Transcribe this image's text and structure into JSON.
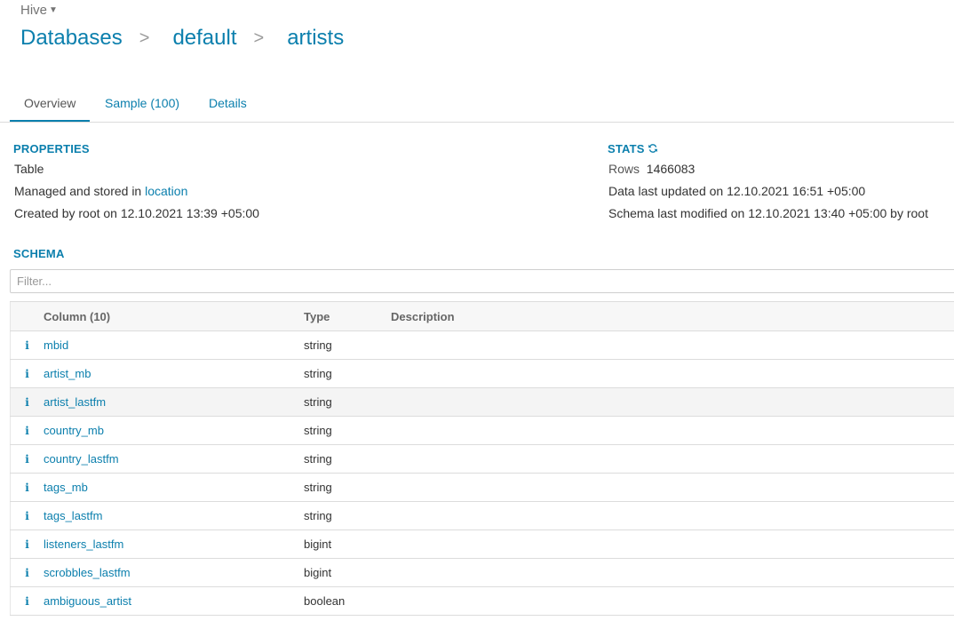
{
  "app": {
    "name": "Hive"
  },
  "breadcrumb": {
    "items": [
      "Databases",
      "default",
      "artists"
    ],
    "separator": ">"
  },
  "tabs": [
    {
      "label": "Overview",
      "active": true
    },
    {
      "label": "Sample (100)",
      "active": false
    },
    {
      "label": "Details",
      "active": false
    }
  ],
  "properties": {
    "title": "PROPERTIES",
    "type": "Table",
    "storage_prefix": "Managed and stored in",
    "storage_link": "location",
    "created": "Created by root on 12.10.2021 13:39 +05:00"
  },
  "stats": {
    "title": "STATS",
    "rows_label": "Rows",
    "rows_value": "1466083",
    "data_updated": "Data last updated on 12.10.2021 16:51 +05:00",
    "schema_modified": "Schema last modified on 12.10.2021 13:40 +05:00 by root"
  },
  "schema": {
    "title": "SCHEMA",
    "filter_placeholder": "Filter...",
    "headers": {
      "column": "Column (10)",
      "type": "Type",
      "description": "Description"
    },
    "rows": [
      {
        "name": "mbid",
        "type": "string",
        "description": ""
      },
      {
        "name": "artist_mb",
        "type": "string",
        "description": ""
      },
      {
        "name": "artist_lastfm",
        "type": "string",
        "description": ""
      },
      {
        "name": "country_mb",
        "type": "string",
        "description": ""
      },
      {
        "name": "country_lastfm",
        "type": "string",
        "description": ""
      },
      {
        "name": "tags_mb",
        "type": "string",
        "description": ""
      },
      {
        "name": "tags_lastfm",
        "type": "string",
        "description": ""
      },
      {
        "name": "listeners_lastfm",
        "type": "bigint",
        "description": ""
      },
      {
        "name": "scrobbles_lastfm",
        "type": "bigint",
        "description": ""
      },
      {
        "name": "ambiguous_artist",
        "type": "boolean",
        "description": ""
      }
    ],
    "highlighted_row": 2
  },
  "colors": {
    "accent": "#0B7FAD",
    "text": "#333333",
    "border": "#dcdcdc"
  }
}
